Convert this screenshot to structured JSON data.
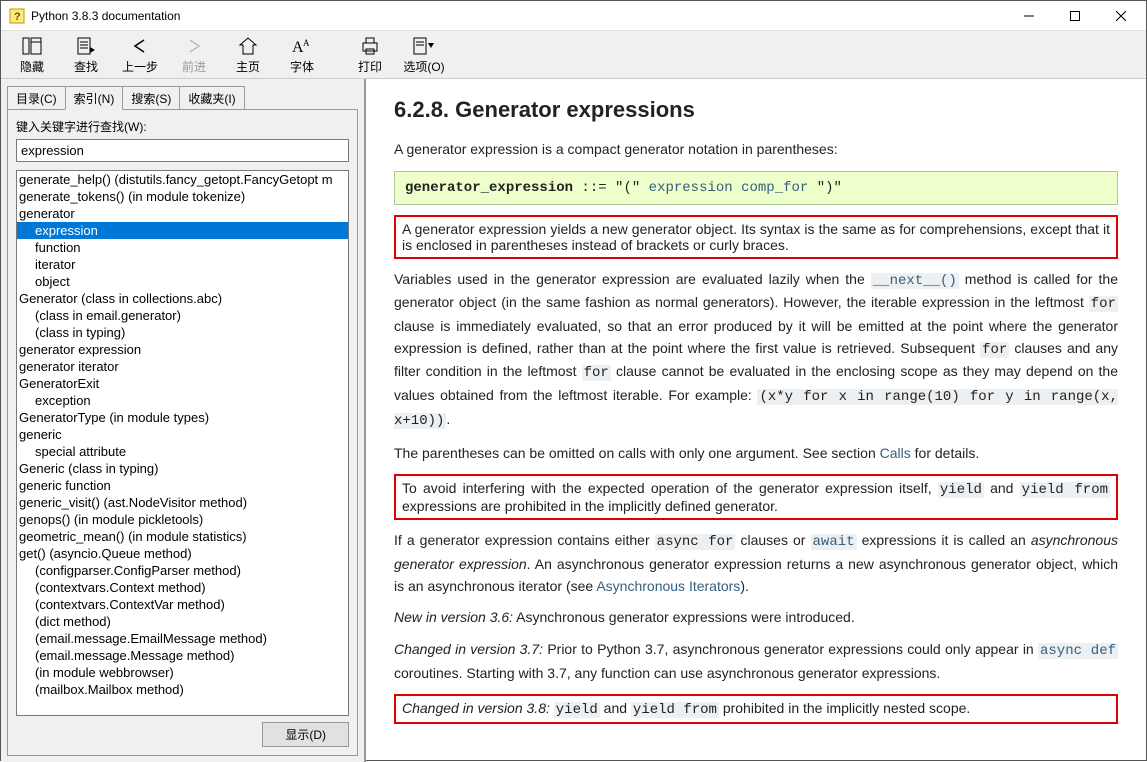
{
  "window": {
    "title": "Python 3.8.3 documentation"
  },
  "toolbar": {
    "hide": "隐藏",
    "find": "查找",
    "back": "上一步",
    "forward": "前进",
    "home": "主页",
    "font": "字体",
    "print": "打印",
    "options": "选项(O)"
  },
  "tabs": {
    "contents": "目录(C)",
    "index": "索引(N)",
    "search": "搜索(S)",
    "favorites": "收藏夹(I)"
  },
  "sidebar": {
    "prompt": "键入关键字进行查找(W):",
    "input_value": "expression",
    "show_btn": "显示(D)",
    "items": [
      {
        "t": "generate_help() (distutils.fancy_getopt.FancyGetopt m",
        "i": 0
      },
      {
        "t": "generate_tokens() (in module tokenize)",
        "i": 0
      },
      {
        "t": "generator",
        "i": 0
      },
      {
        "t": "expression",
        "i": 1,
        "sel": true
      },
      {
        "t": "function",
        "i": 1
      },
      {
        "t": "iterator",
        "i": 1
      },
      {
        "t": "object",
        "i": 1
      },
      {
        "t": "Generator (class in collections.abc)",
        "i": 0
      },
      {
        "t": "(class in email.generator)",
        "i": 1
      },
      {
        "t": "(class in typing)",
        "i": 1
      },
      {
        "t": "generator expression",
        "i": 0
      },
      {
        "t": "generator iterator",
        "i": 0
      },
      {
        "t": "GeneratorExit",
        "i": 0
      },
      {
        "t": "exception",
        "i": 1
      },
      {
        "t": "GeneratorType (in module types)",
        "i": 0
      },
      {
        "t": "generic",
        "i": 0
      },
      {
        "t": "special attribute",
        "i": 1
      },
      {
        "t": "Generic (class in typing)",
        "i": 0
      },
      {
        "t": "generic function",
        "i": 0
      },
      {
        "t": "generic_visit() (ast.NodeVisitor method)",
        "i": 0
      },
      {
        "t": "genops() (in module pickletools)",
        "i": 0
      },
      {
        "t": "geometric_mean() (in module statistics)",
        "i": 0
      },
      {
        "t": "get() (asyncio.Queue method)",
        "i": 0
      },
      {
        "t": "(configparser.ConfigParser method)",
        "i": 1
      },
      {
        "t": "(contextvars.Context method)",
        "i": 1
      },
      {
        "t": "(contextvars.ContextVar method)",
        "i": 1
      },
      {
        "t": "(dict method)",
        "i": 1
      },
      {
        "t": "(email.message.EmailMessage method)",
        "i": 1
      },
      {
        "t": "(email.message.Message method)",
        "i": 1
      },
      {
        "t": "(in module webbrowser)",
        "i": 1
      },
      {
        "t": "(mailbox.Mailbox method)",
        "i": 1
      }
    ]
  },
  "doc": {
    "heading": "6.2.8. Generator expressions",
    "p1": "A generator expression is a compact generator notation in parentheses:",
    "grammar_lhs": "generator_expression",
    "grammar_sep": " ::=  ",
    "grammar_q1": "\"(\"",
    "grammar_expr": " expression",
    "grammar_comp": " comp_for",
    "grammar_q2": " \")\"",
    "red1": "A generator expression yields a new generator object. Its syntax is the same as for comprehensions, except that it is enclosed in parentheses instead of brackets or curly braces.",
    "p2a": "Variables used in the generator expression are evaluated lazily when the ",
    "p2_next": "__next__()",
    "p2b": " method is called for the generator object (in the same fashion as normal generators). However, the iterable expression in the leftmost ",
    "p2_for1": "for",
    "p2c": " clause is immediately evaluated, so that an error produced by it will be emitted at the point where the generator expression is defined, rather than at the point where the first value is retrieved. Subsequent ",
    "p2_for2": "for",
    "p2d": " clauses and any filter condition in the leftmost ",
    "p2_for3": "for",
    "p2e": " clause cannot be evaluated in the enclosing scope as they may depend on the values obtained from the leftmost iterable. For example: ",
    "p2_code": "(x*y for x in range(10) for y in range(x, x+10))",
    "p2f": ".",
    "p3a": "The parentheses can be omitted on calls with only one argument. See section ",
    "p3_calls": "Calls",
    "p3b": " for details.",
    "red2a": "To avoid interfering with the expected operation of the generator expression itself, ",
    "red2_yield": "yield",
    "red2b": " and ",
    "red2_yf": "yield from",
    "red2c": " expressions are prohibited in the implicitly defined generator.",
    "p4a": "If a generator expression contains either ",
    "p4_af": "async for",
    "p4b": " clauses or ",
    "p4_aw": "await",
    "p4c": " expressions it is called an ",
    "p4_em": "asynchronous generator expression",
    "p4d": ". An asynchronous generator expression returns a new asynchronous generator object, which is an asynchronous iterator (see ",
    "p4_ai": "Asynchronous Iterators",
    "p4e": ").",
    "p5_em": "New in version 3.6:",
    "p5": " Asynchronous generator expressions were introduced.",
    "p6_em": "Changed in version 3.7:",
    "p6a": " Prior to Python 3.7, asynchronous generator expressions could only appear in ",
    "p6_ad": "async def",
    "p6b": " coroutines. Starting with 3.7, any function can use asynchronous generator expressions.",
    "red3_em": "Changed in version 3.8:",
    "red3a": " ",
    "red3_y": "yield",
    "red3b": " and ",
    "red3_yf": "yield from",
    "red3c": " prohibited in the implicitly nested scope."
  }
}
